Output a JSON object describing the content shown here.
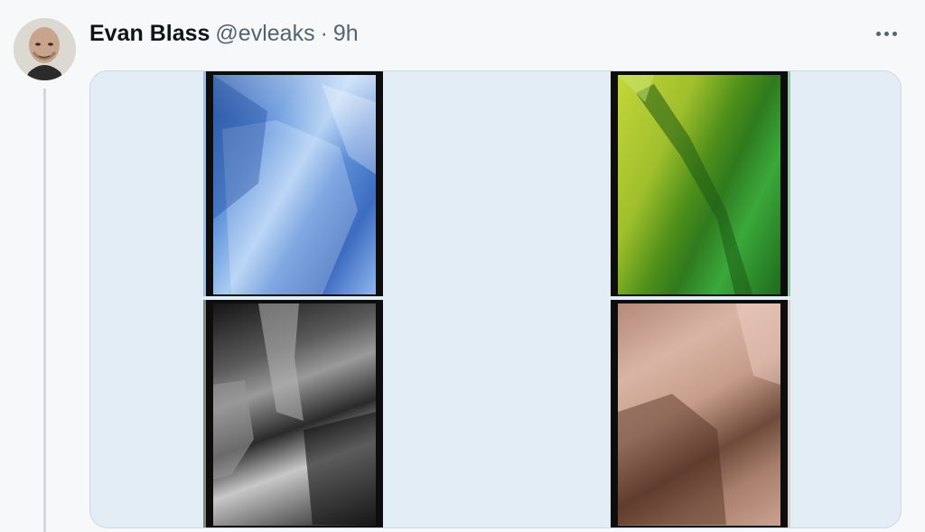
{
  "tweet": {
    "author_name": "Evan Blass",
    "handle": "@evleaks",
    "separator": "·",
    "time": "9h"
  },
  "icons": {
    "more": "more-horizontal-icon",
    "avatar": "user-avatar"
  },
  "media": {
    "images": [
      "blue-crystal-wallpaper",
      "green-crystal-wallpaper",
      "black-crystal-wallpaper",
      "rose-quartz-wallpaper"
    ]
  },
  "colors": {
    "name": "#0f1419",
    "secondary": "#536471",
    "media_bg": "#e2edf5",
    "thread_line": "#cfd9de"
  }
}
